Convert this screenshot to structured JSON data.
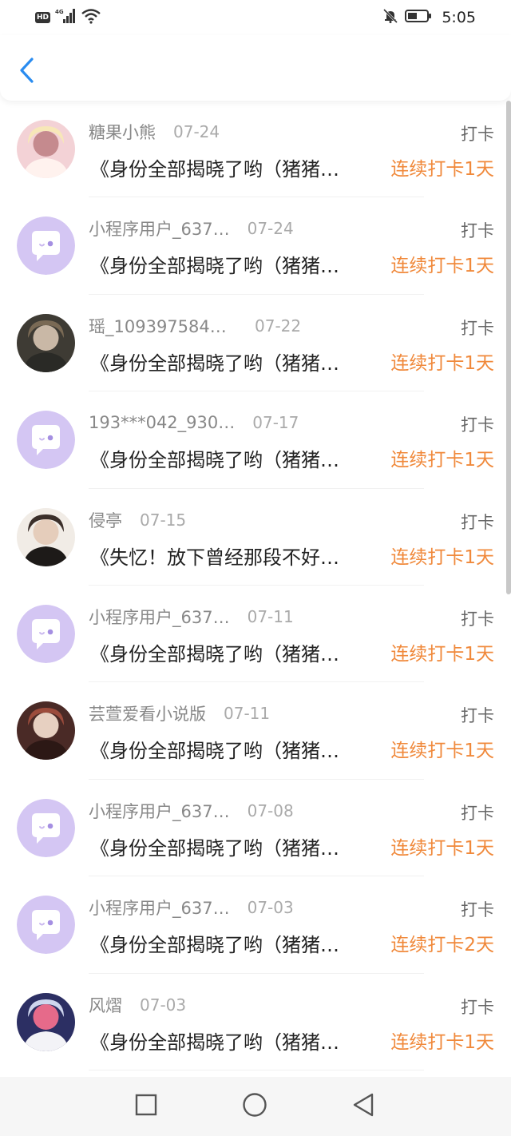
{
  "status_bar": {
    "hd": "HD",
    "network": "4G",
    "time": "5:05"
  },
  "nav": {
    "back_icon": "chevron-left-icon",
    "accent_color": "#2a8cf0"
  },
  "list": {
    "items": [
      {
        "name": "糖果小熊",
        "date": "07-24",
        "type": "打卡",
        "title": "《身份全部揭晓了哟（猪猪…",
        "streak": "连续打卡1天",
        "avatar": "photo-avatar-anime-girl"
      },
      {
        "name": "小程序用户_637…",
        "date": "07-24",
        "type": "打卡",
        "title": "《身份全部揭晓了哟（猪猪…",
        "streak": "连续打卡1天",
        "avatar": "default-chat-avatar"
      },
      {
        "name": "瑶_1093975848…",
        "date": "07-22",
        "type": "打卡",
        "title": "《身份全部揭晓了哟（猪猪…",
        "streak": "连续打卡1天",
        "avatar": "photo-avatar-person"
      },
      {
        "name": "193***042_930…",
        "date": "07-17",
        "type": "打卡",
        "title": "《身份全部揭晓了哟（猪猪…",
        "streak": "连续打卡1天",
        "avatar": "default-chat-avatar"
      },
      {
        "name": "侵亭",
        "date": "07-15",
        "type": "打卡",
        "title": "《失忆！放下曾经那段不好…",
        "streak": "连续打卡1天",
        "avatar": "photo-avatar-girl-glasses"
      },
      {
        "name": "小程序用户_637…",
        "date": "07-11",
        "type": "打卡",
        "title": "《身份全部揭晓了哟（猪猪…",
        "streak": "连续打卡1天",
        "avatar": "default-chat-avatar"
      },
      {
        "name": "芸萱爱看小说版",
        "date": "07-11",
        "type": "打卡",
        "title": "《身份全部揭晓了哟（猪猪…",
        "streak": "连续打卡1天",
        "avatar": "photo-avatar-anime-elf"
      },
      {
        "name": "小程序用户_637…",
        "date": "07-08",
        "type": "打卡",
        "title": "《身份全部揭晓了哟（猪猪…",
        "streak": "连续打卡1天",
        "avatar": "default-chat-avatar"
      },
      {
        "name": "小程序用户_637…",
        "date": "07-03",
        "type": "打卡",
        "title": "《身份全部揭晓了哟（猪猪…",
        "streak": "连续打卡2天",
        "avatar": "default-chat-avatar"
      },
      {
        "name": "风熠",
        "date": "07-03",
        "type": "打卡",
        "title": "《身份全部揭晓了哟（猪猪…",
        "streak": "连续打卡1天",
        "avatar": "photo-avatar-anime-blue"
      }
    ]
  },
  "system_nav": {
    "recent_icon": "square-icon",
    "home_icon": "circle-icon",
    "back_icon": "triangle-back-icon"
  },
  "colors": {
    "streak": "#f0893b",
    "default_avatar_bg": "#d4c6f3",
    "name": "#888888"
  }
}
